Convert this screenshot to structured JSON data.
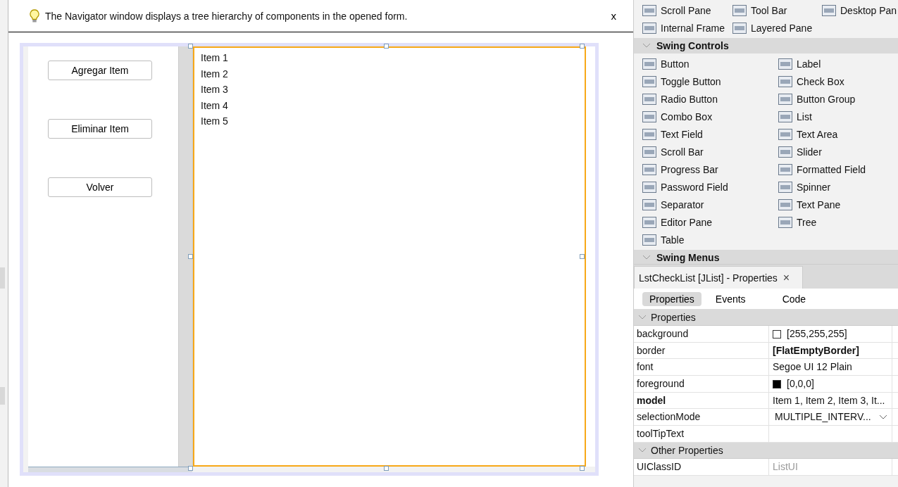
{
  "tip": {
    "text": "The Navigator window displays a tree hierarchy of components in the opened form.",
    "close": "x"
  },
  "form": {
    "buttons": [
      "Agregar Item",
      "Eliminar Item",
      "Volver"
    ],
    "list_items": [
      "Item 1",
      "Item 2",
      "Item 3",
      "Item 4",
      "Item 5"
    ]
  },
  "palette": {
    "top_rows": [
      [
        "Scroll Pane",
        "Tool Bar",
        "Desktop Pan"
      ],
      [
        "Internal Frame",
        "Layered Pane"
      ]
    ],
    "sections": [
      {
        "title": "Swing Controls",
        "expanded": true,
        "items": [
          "Button",
          "Label",
          "Toggle Button",
          "Check Box",
          "Radio Button",
          "Button Group",
          "Combo Box",
          "List",
          "Text Field",
          "Text Area",
          "Scroll Bar",
          "Slider",
          "Progress Bar",
          "Formatted Field",
          "Password Field",
          "Spinner",
          "Separator",
          "Text Pane",
          "Editor Pane",
          "Tree",
          "Table"
        ]
      },
      {
        "title": "Swing Menus",
        "expanded": true
      }
    ]
  },
  "properties_window": {
    "title": "LstCheckList [JList] - Properties",
    "close": "×",
    "tabs": [
      {
        "label": "Properties",
        "selected": true
      },
      {
        "label": "Events",
        "selected": false
      },
      {
        "label": "Code",
        "selected": false
      }
    ],
    "sections": [
      {
        "title": "Properties",
        "expanded": true,
        "rows": [
          {
            "kind": "color",
            "name": "background",
            "value": "[255,255,255]",
            "color": "#ffffff"
          },
          {
            "kind": "text",
            "name": "border",
            "value": "[FlatEmptyBorder]",
            "value_bold": true
          },
          {
            "kind": "text",
            "name": "font",
            "value": "Segoe UI 12 Plain"
          },
          {
            "kind": "color",
            "name": "foreground",
            "value": "[0,0,0]",
            "color": "#000000"
          },
          {
            "kind": "text",
            "name": "model",
            "value": "Item 1, Item 2, Item 3, It...",
            "name_bold": true
          },
          {
            "kind": "dropdown",
            "name": "selectionMode",
            "value": "MULTIPLE_INTERV..."
          },
          {
            "kind": "text",
            "name": "toolTipText"
          }
        ]
      },
      {
        "title": "Other Properties",
        "expanded": true,
        "rows": [
          {
            "kind": "text",
            "name": "UIClassID",
            "value": "ListUI",
            "value_dimmed": true
          }
        ]
      }
    ]
  }
}
